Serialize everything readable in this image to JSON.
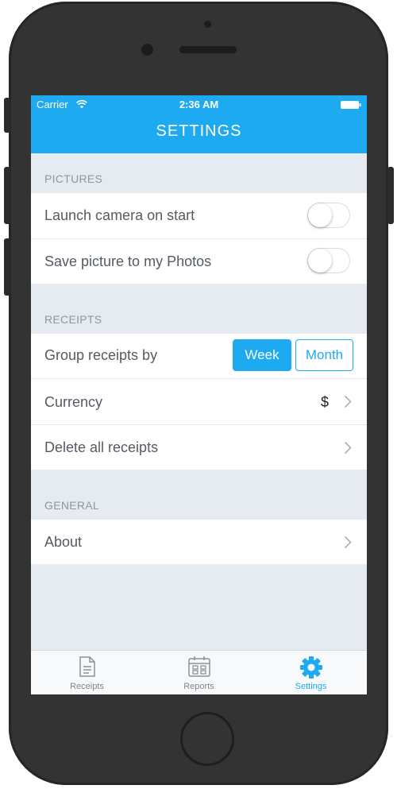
{
  "status_bar": {
    "carrier": "Carrier",
    "time": "2:36 AM"
  },
  "header": {
    "title": "SETTINGS"
  },
  "sections": {
    "pictures": {
      "label": "PICTURES",
      "items": [
        {
          "label": "Launch camera on start",
          "enabled": false
        },
        {
          "label": "Save picture to my Photos",
          "enabled": false
        }
      ]
    },
    "receipts": {
      "label": "RECEIPTS",
      "group_by": {
        "label": "Group receipts by",
        "options": [
          "Week",
          "Month"
        ],
        "selected": "Week"
      },
      "currency": {
        "label": "Currency",
        "value": "$"
      },
      "delete": {
        "label": "Delete all receipts"
      }
    },
    "general": {
      "label": "GENERAL",
      "about": {
        "label": "About"
      }
    }
  },
  "tabbar": {
    "tabs": [
      {
        "label": "Receipts",
        "icon": "receipt-icon"
      },
      {
        "label": "Reports",
        "icon": "calendar-icon"
      },
      {
        "label": "Settings",
        "icon": "gear-icon"
      }
    ],
    "active": "Settings"
  },
  "colors": {
    "accent": "#1eaaf1",
    "background": "#e6ebf1",
    "frame": "#333333"
  }
}
